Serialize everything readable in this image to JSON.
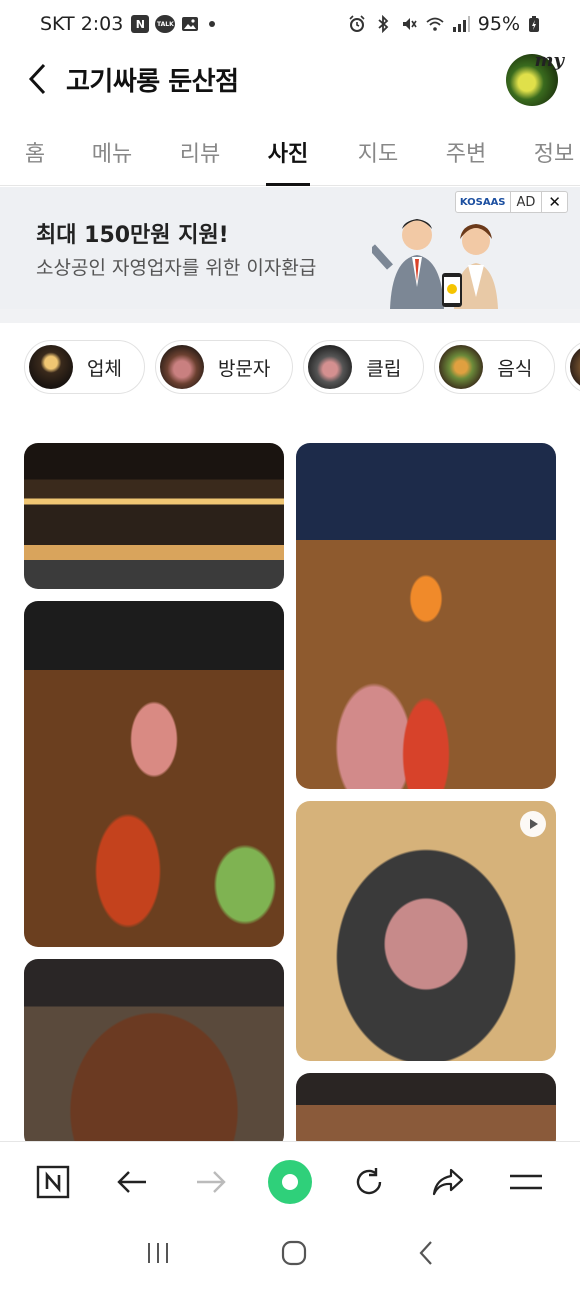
{
  "status_bar": {
    "carrier_time": "SKT 2:03",
    "notif_n": "N",
    "notif_talk": "TALK",
    "battery": "95%"
  },
  "header": {
    "title": "고기싸롱 둔산점",
    "avatar_label": "my"
  },
  "tabs": [
    {
      "label": "홈",
      "active": false
    },
    {
      "label": "메뉴",
      "active": false
    },
    {
      "label": "리뷰",
      "active": false
    },
    {
      "label": "사진",
      "active": true
    },
    {
      "label": "지도",
      "active": false
    },
    {
      "label": "주변",
      "active": false
    },
    {
      "label": "정보",
      "active": false
    }
  ],
  "ad": {
    "title": "최대 150만원 지원!",
    "subtitle": "소상공인 자영업자를 위한 이자환급",
    "badge_logo": "KOSAAS",
    "badge_label": "AD",
    "close": "✕"
  },
  "chips": [
    {
      "label": "업체",
      "thumb_color": "#3a2a1c"
    },
    {
      "label": "방문자",
      "thumb_color": "#b0705a"
    },
    {
      "label": "클립",
      "thumb_color": "#4a3a32"
    },
    {
      "label": "음식",
      "thumb_color": "#7a5a2a"
    },
    {
      "label": "",
      "thumb_color": "#8a6a4a"
    }
  ],
  "photos": [
    {
      "name": "storefront-photo"
    },
    {
      "name": "food-table-photo"
    },
    {
      "name": "grilled-beef-photo"
    },
    {
      "name": "grill-table-photo"
    },
    {
      "name": "pork-on-grill-clip"
    },
    {
      "name": "table-bottom-photo"
    }
  ],
  "colors": {
    "accent_green": "#2fd07a",
    "ad_background": "#eef0f3"
  }
}
